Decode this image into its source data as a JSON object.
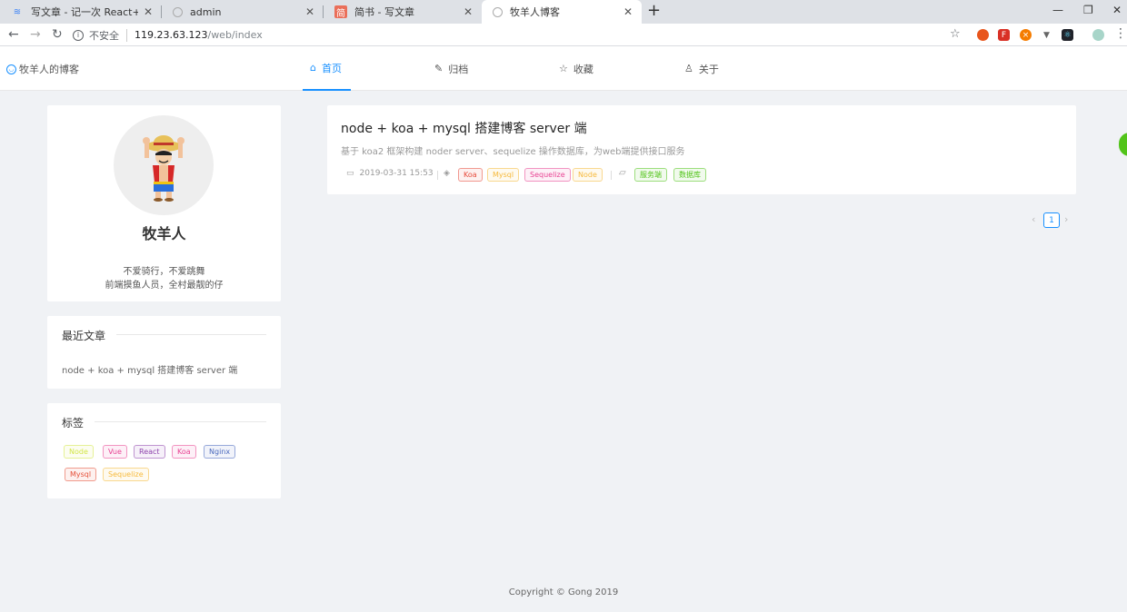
{
  "browser": {
    "tabs": [
      {
        "label": "写文章 - 记一次 React+Koa + M",
        "icon": "feather-icon",
        "active": false
      },
      {
        "label": "admin",
        "icon": "loading-icon",
        "active": false
      },
      {
        "label": "简书 - 写文章",
        "icon": "jianshu-icon",
        "active": false
      },
      {
        "label": "牧羊人博客",
        "icon": "loading-icon",
        "active": true
      }
    ],
    "address": {
      "security_text": "不安全",
      "host": "119.23.63.123",
      "path": "/web/index"
    }
  },
  "header": {
    "logo_text": "牧羊人的博客",
    "nav": [
      {
        "label": "首页",
        "icon": "home-icon",
        "active": true
      },
      {
        "label": "归档",
        "icon": "edit-icon",
        "active": false
      },
      {
        "label": "收藏",
        "icon": "star-icon",
        "active": false
      },
      {
        "label": "关于",
        "icon": "user-icon",
        "active": false
      }
    ]
  },
  "profile": {
    "name": "牧羊人",
    "bio_line1": "不爱骑行，不爱跳舞",
    "bio_line2": "前端摸鱼人员，全村最靓的仔"
  },
  "recent": {
    "title": "最近文章",
    "items": [
      "node + koa + mysql 搭建博客 server 端"
    ]
  },
  "tags_card": {
    "title": "标签",
    "tags": [
      {
        "label": "Node",
        "color": "#d3e648"
      },
      {
        "label": "Vue",
        "color": "#e84393"
      },
      {
        "label": "React",
        "color": "#8e44ad"
      },
      {
        "label": "Koa",
        "color": "#e84393"
      },
      {
        "label": "Nginx",
        "color": "#4a69bd"
      },
      {
        "label": "Mysql",
        "color": "#e55039"
      },
      {
        "label": "Sequelize",
        "color": "#f6b93b"
      }
    ]
  },
  "post": {
    "title": "node + koa + mysql 搭建博客 server 端",
    "description": "基于 koa2 框架构建 noder server、sequelize 操作数据库，为web端提供接口服务",
    "date": "2019-03-31 15:53",
    "tags": [
      {
        "label": "Koa",
        "color": "#e74c3c"
      },
      {
        "label": "Mysql",
        "color": "#f6b93b"
      },
      {
        "label": "Sequelize",
        "color": "#e84393"
      },
      {
        "label": "Node",
        "color": "#f6b93b"
      }
    ],
    "categories": [
      {
        "label": "服务端",
        "color": "#52c41a"
      },
      {
        "label": "数据库",
        "color": "#52c41a"
      }
    ]
  },
  "pagination": {
    "current": "1"
  },
  "footer": {
    "copyright": "Copyright © Gong 2019"
  }
}
